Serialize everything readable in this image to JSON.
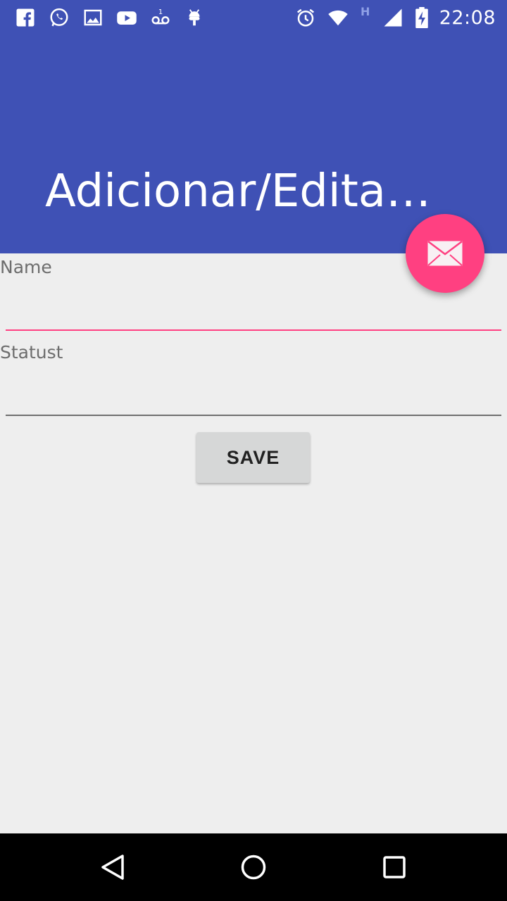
{
  "status_bar": {
    "time": "22:08",
    "network_type": "H",
    "notification_icons": [
      "facebook-icon",
      "whatsapp-icon",
      "image-icon",
      "youtube-icon",
      "voicemail-icon",
      "android-icon"
    ],
    "system_icons": [
      "alarm-icon",
      "wifi-icon",
      "signal-icon",
      "battery-charging-icon"
    ]
  },
  "app_bar": {
    "title": "Adicionar/Editar I...",
    "color": "#3f51b5"
  },
  "fab": {
    "icon": "email-icon",
    "color": "#ff4081"
  },
  "form": {
    "name_label": "Name",
    "name_value": "",
    "status_label": "Statust",
    "status_value": "",
    "save_label": "SAVE"
  },
  "nav_bar": {
    "back": "back-icon",
    "home": "home-icon",
    "recents": "recents-icon"
  }
}
